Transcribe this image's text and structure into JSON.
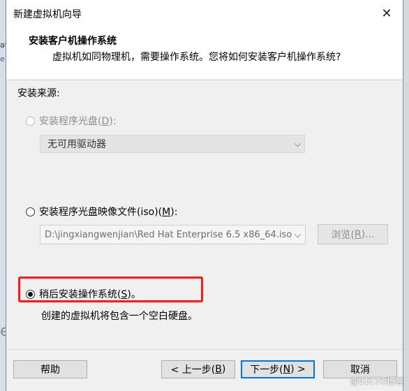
{
  "dialog": {
    "title": "新建虚拟机向导",
    "close_glyph": "✕"
  },
  "header": {
    "title": "安装客户机操作系统",
    "subtitle": "虚拟机如同物理机，需要操作系统。您将如何安装客户机操作系统?"
  },
  "source": {
    "label": "安装来源:",
    "disc_option": {
      "text": "安装程序光盘(",
      "key": "D",
      "suffix": "):",
      "selected": false,
      "enabled": false
    },
    "drive_select_value": "无可用驱动器",
    "iso_option": {
      "text": "安装程序光盘映像文件(iso)(",
      "key": "M",
      "suffix": "):",
      "selected": false,
      "enabled": true
    },
    "iso_path": "D:\\jingxiangwenjian\\Red Hat Enterprise 6.5 x86_64.iso",
    "browse_button": {
      "text": "浏览(",
      "key": "R",
      "suffix": ")..."
    },
    "later_option": {
      "text": "稍后安装操作系统(",
      "key": "S",
      "suffix": ")。",
      "selected": true,
      "enabled": true
    },
    "later_description": "创建的虚拟机将包含一个空白硬盘。"
  },
  "footer": {
    "help": "帮助",
    "back": {
      "text": "< 上一步(",
      "key": "B",
      "suffix": ")"
    },
    "next": {
      "text": "下一步(",
      "key": "N",
      "suffix": ") >"
    },
    "cancel": "取消"
  },
  "background": {
    "left_fragment_1": "at",
    "left_fragment_2": "e",
    "left_fragment_3": "e"
  },
  "watermark": "@51CTO博客",
  "colors": {
    "highlight": "#e02626",
    "default_button_border": "#0078d7"
  }
}
